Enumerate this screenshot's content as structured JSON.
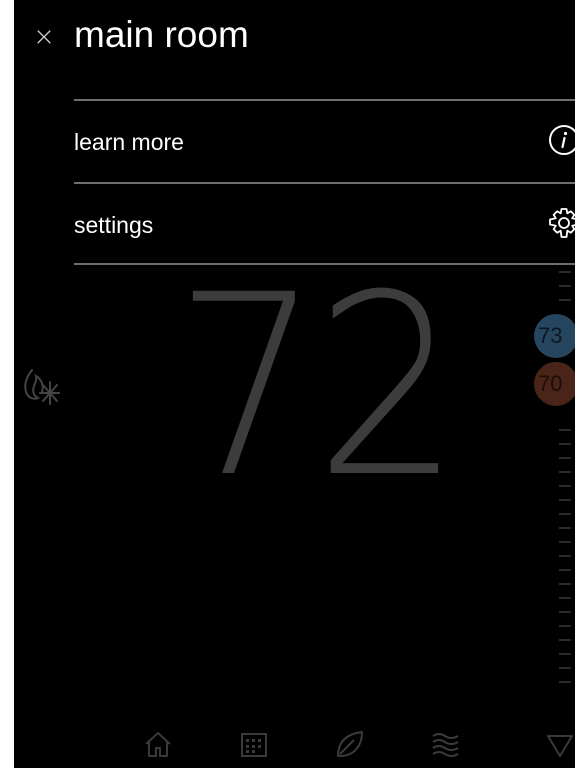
{
  "thermostat": {
    "current_temp": "72",
    "cool_setpoint": "73",
    "heat_setpoint": "70",
    "mode_icon": "flame-snowflake-icon"
  },
  "menu": {
    "close_glyph": "×",
    "title": "main room",
    "items": [
      {
        "label": "learn more",
        "icon": "info-icon"
      },
      {
        "label": "settings",
        "icon": "gear-icon"
      }
    ]
  },
  "bottom_nav": {
    "icons": [
      "home-icon",
      "calendar-icon",
      "leaf-icon",
      "air-waves-icon",
      "triangle-down-icon"
    ]
  },
  "colors": {
    "background": "#000000",
    "text": "#ffffff",
    "divider": "#6e6e6e",
    "cool_setpoint": "#26455e",
    "heat_setpoint": "#4a2418"
  }
}
